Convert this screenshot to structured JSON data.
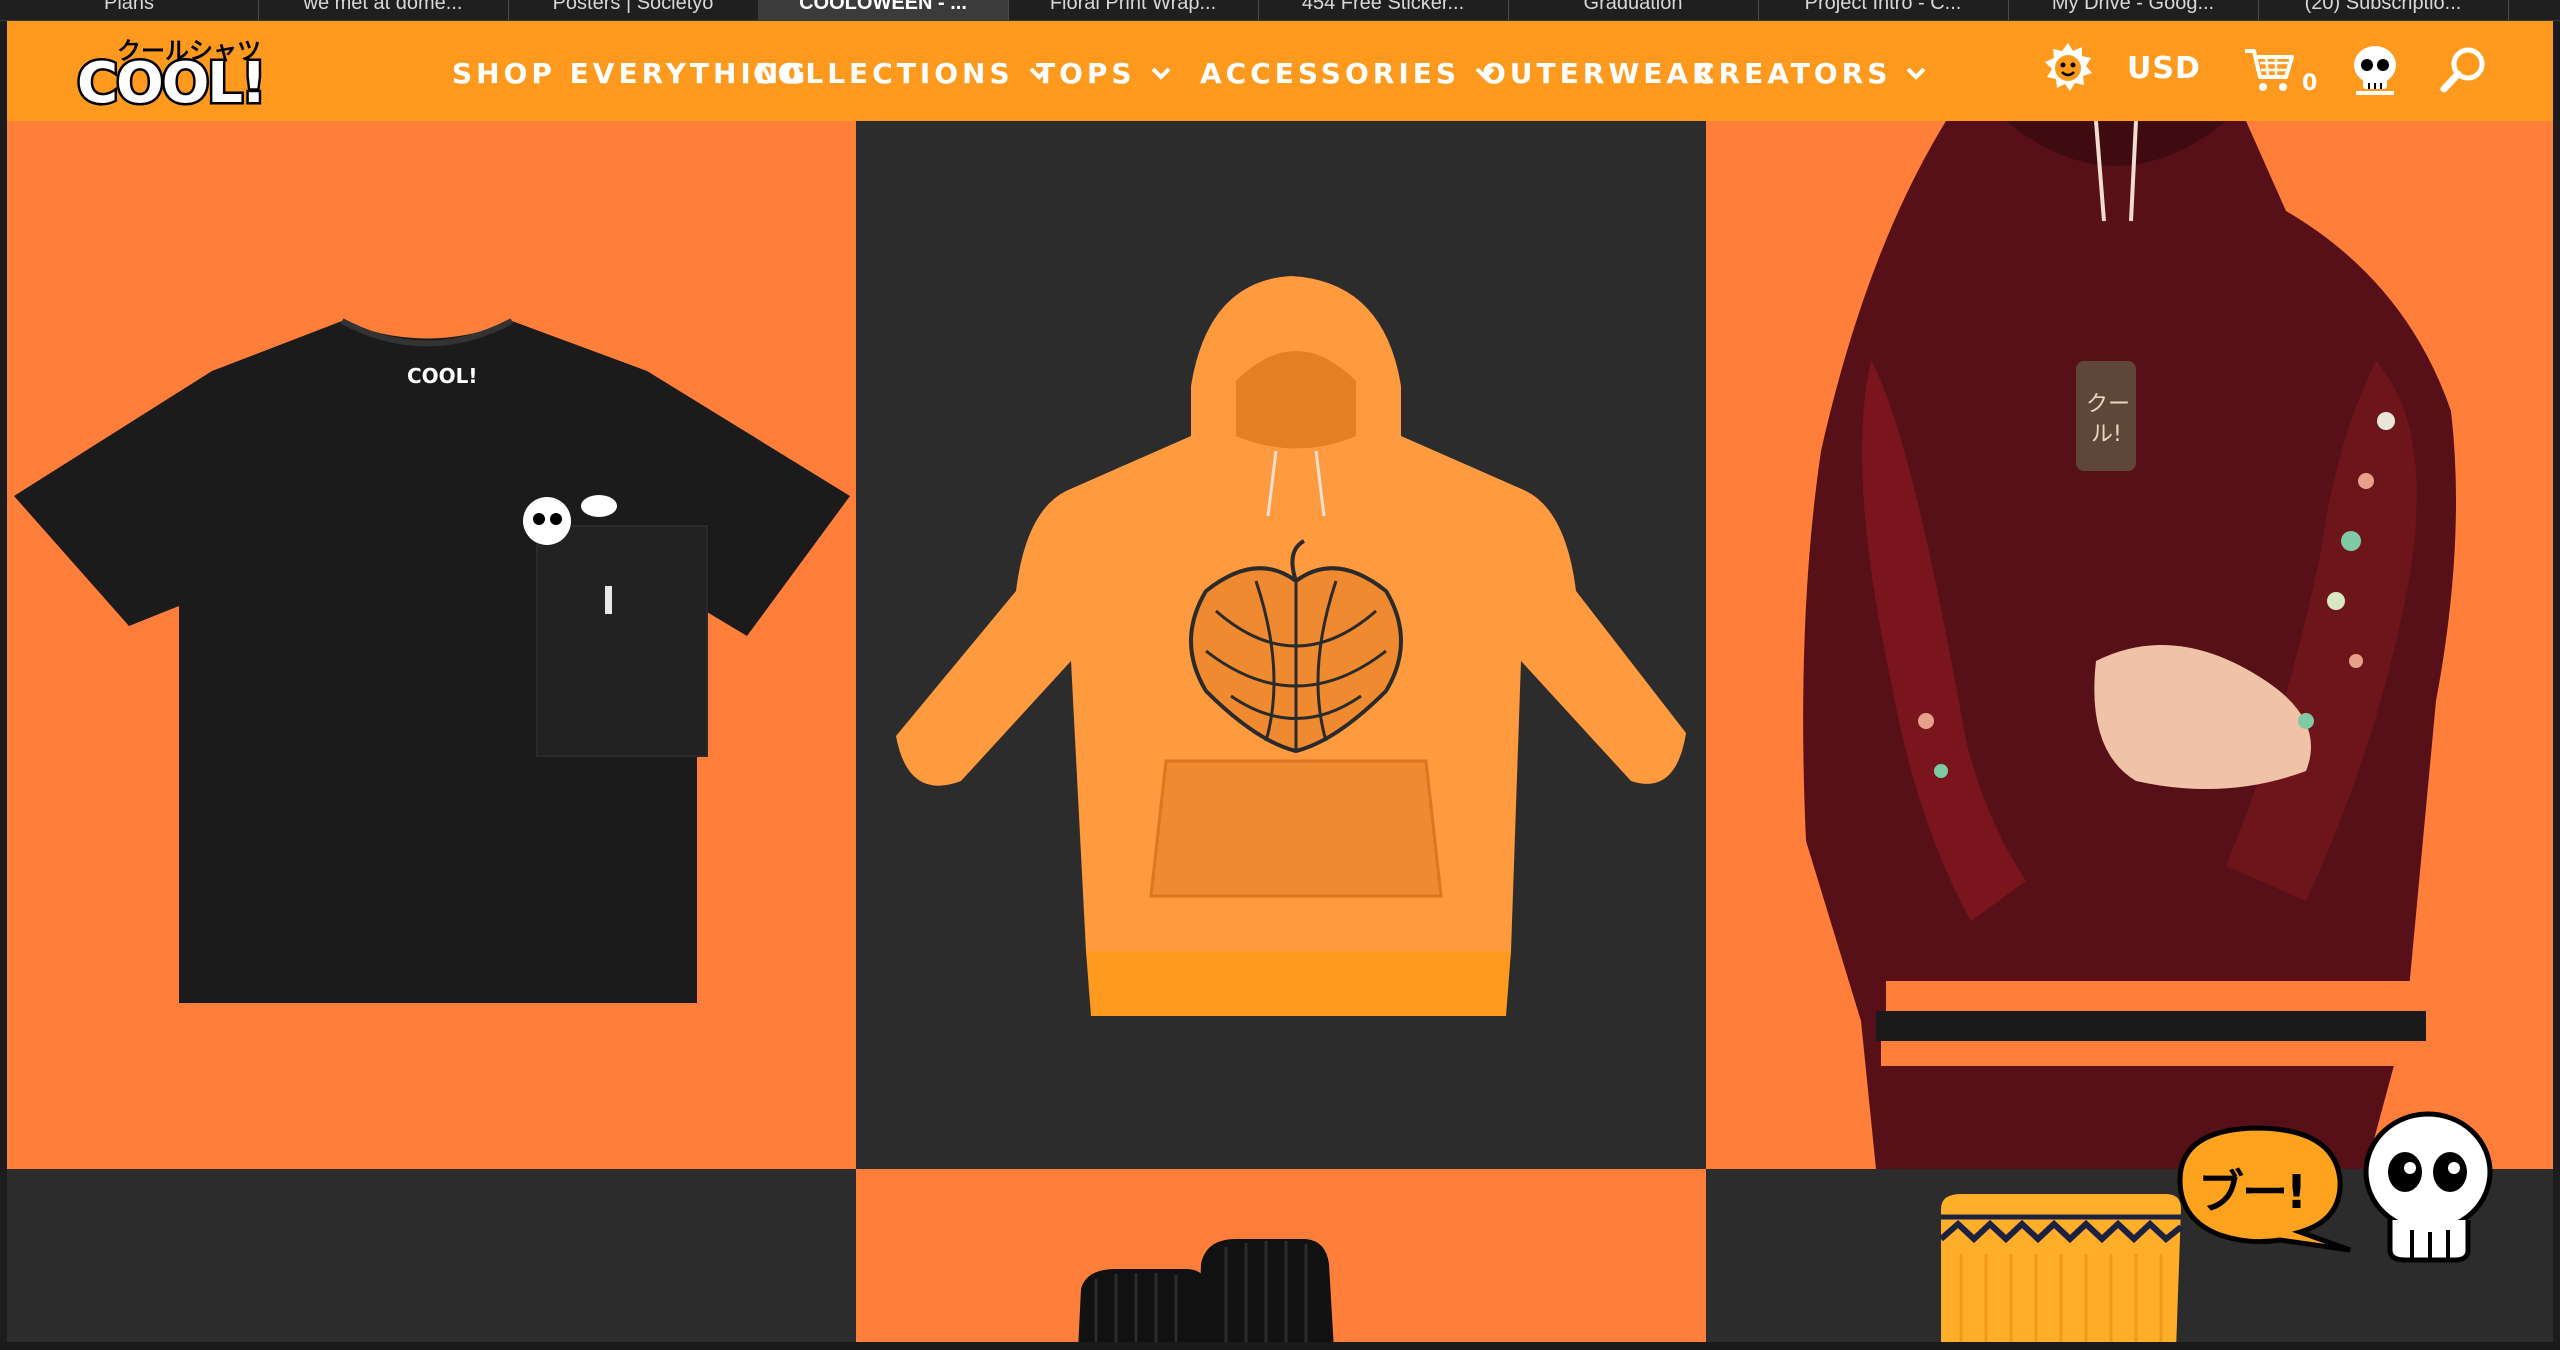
{
  "browser": {
    "tabs": [
      {
        "label": "Plans",
        "active": false
      },
      {
        "label": "we met at dome...",
        "active": false
      },
      {
        "label": "Posters | Societyo",
        "active": false
      },
      {
        "label": "COOLOWEEN - ...",
        "active": true
      },
      {
        "label": "Floral Print Wrap...",
        "active": false
      },
      {
        "label": "454 Free Sticker...",
        "active": false
      },
      {
        "label": "Graduation",
        "active": false
      },
      {
        "label": "Project Intro - C...",
        "active": false
      },
      {
        "label": "My Drive - Goog...",
        "active": false
      },
      {
        "label": "(20) Subscriptio...",
        "active": false
      }
    ]
  },
  "header": {
    "logo": {
      "kana": "クールシャツ",
      "word": "COOL!"
    },
    "nav": [
      {
        "label": "SHOP EVERYTHING",
        "dropdown": false
      },
      {
        "label": "COLLECTIONS",
        "dropdown": true
      },
      {
        "label": "TOPS",
        "dropdown": true
      },
      {
        "label": "ACCESSORIES",
        "dropdown": true
      },
      {
        "label": "OUTERWEAR",
        "dropdown": false
      },
      {
        "label": "CREATORS",
        "dropdown": true
      }
    ],
    "currency": "USD",
    "cart_count": "0",
    "icons": [
      "sun-face-icon",
      "cart-icon",
      "skull-account-icon",
      "search-icon"
    ]
  },
  "products": [
    {
      "name": "black-pocket-tee",
      "bg": "#ff7f3a"
    },
    {
      "name": "orange-pumpkin-hoodie",
      "bg": "#2c2c2c"
    },
    {
      "name": "maroon-embroidered-hoodie-model",
      "bg": "#ff7f3a"
    },
    {
      "name": "partial-product",
      "bg": "#2c2c2c"
    },
    {
      "name": "black-socks",
      "bg": "#ff7f3a"
    },
    {
      "name": "orange-striped-socks",
      "bg": "#2c2c2c"
    }
  ],
  "mascot": {
    "speech": "ブー!"
  },
  "colors": {
    "brand_orange": "#ff9a1f",
    "tile_orange": "#ff7f3a",
    "tile_dark": "#2c2c2c"
  }
}
